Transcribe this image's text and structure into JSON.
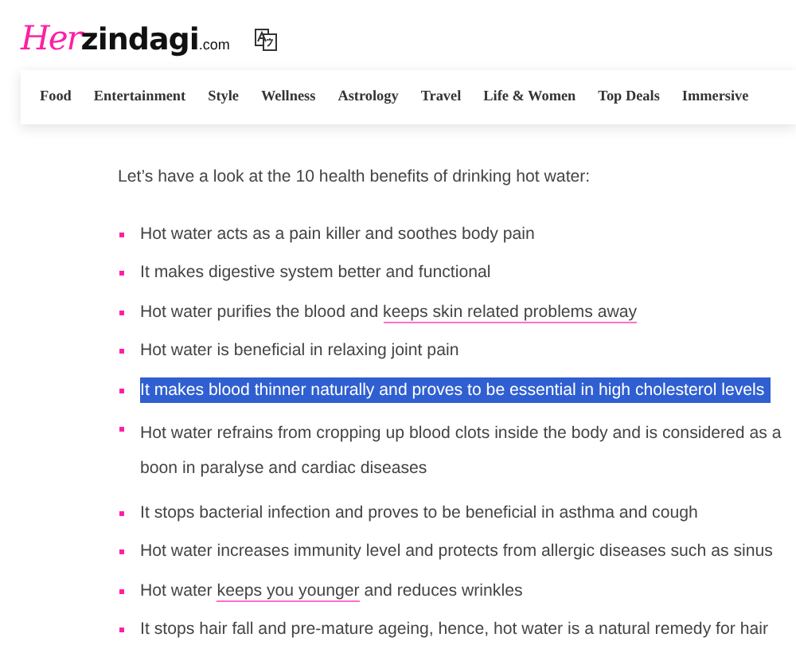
{
  "logo": {
    "script": "Her",
    "name": "zindagi",
    "suffix": ".com"
  },
  "nav": [
    "Food",
    "Entertainment",
    "Style",
    "Wellness",
    "Astrology",
    "Travel",
    "Life & Women",
    "Top Deals",
    "Immersive"
  ],
  "intro": "Let’s have a look at the 10 health benefits of drinking hot water:",
  "items": [
    {
      "highlighted": false,
      "parts": [
        {
          "text": "Hot water acts as a pain killer and soothes body pain",
          "link": false
        }
      ]
    },
    {
      "highlighted": false,
      "parts": [
        {
          "text": "It makes digestive system better and functional",
          "link": false
        }
      ]
    },
    {
      "highlighted": false,
      "parts": [
        {
          "text": "Hot water purifies the blood and ",
          "link": false
        },
        {
          "text": "keeps skin related problems away",
          "link": true
        }
      ]
    },
    {
      "highlighted": false,
      "parts": [
        {
          "text": "Hot water is beneficial in relaxing joint pain",
          "link": false
        }
      ]
    },
    {
      "highlighted": true,
      "parts": [
        {
          "text": "It makes blood thinner naturally and proves to be essential in high cholesterol levels",
          "link": false
        }
      ]
    },
    {
      "highlighted": false,
      "parts": [
        {
          "text": "Hot water refrains from cropping up blood clots inside the body and is considered as a boon in paralyse and cardiac diseases",
          "link": false
        }
      ]
    },
    {
      "highlighted": false,
      "parts": [
        {
          "text": "It stops bacterial infection and proves to be beneficial in asthma and cough",
          "link": false
        }
      ]
    },
    {
      "highlighted": false,
      "parts": [
        {
          "text": "Hot water increases immunity level and protects from allergic diseases such as sinus",
          "link": false
        }
      ]
    },
    {
      "highlighted": false,
      "parts": [
        {
          "text": "Hot water ",
          "link": false
        },
        {
          "text": "keeps you younger",
          "link": true
        },
        {
          "text": " and reduces wrinkles",
          "link": false
        }
      ]
    },
    {
      "highlighted": false,
      "parts": [
        {
          "text": "It stops hair fall and pre-mature ageing, hence, hot water is a natural remedy for hair",
          "link": false
        }
      ]
    }
  ]
}
